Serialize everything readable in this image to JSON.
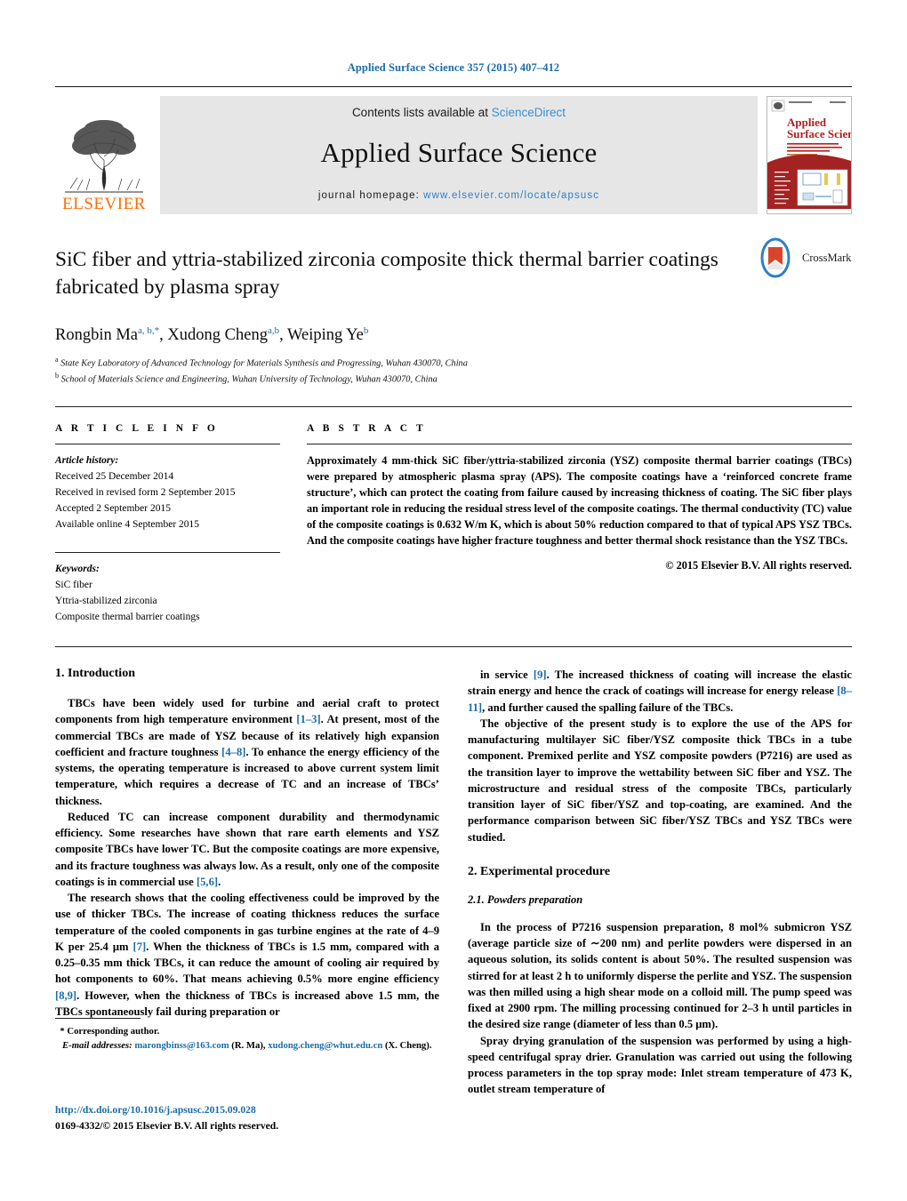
{
  "running_head": "Applied Surface Science 357 (2015) 407–412",
  "masthead": {
    "contents_prefix": "Contents lists available at ",
    "sciencedirect": "ScienceDirect",
    "journal_title": "Applied Surface Science",
    "homepage_prefix": "journal homepage: ",
    "homepage_url": "www.elsevier.com/locate/apsusc",
    "publisher_wordmark": "ELSEVIER",
    "cover_title_line1": "Applied",
    "cover_title_line2": "Surface Science",
    "accent_link_color": "#2f7fc4",
    "running_head_color": "#1b6ca8"
  },
  "article": {
    "title": "SiC fiber and yttria-stabilized zirconia composite thick thermal barrier coatings fabricated by plasma spray",
    "crossmark_label": "CrossMark",
    "authors": [
      {
        "name": "Rongbin Ma",
        "marks": "a, b,*"
      },
      {
        "name": "Xudong Cheng",
        "marks": "a,b"
      },
      {
        "name": "Weiping Ye",
        "marks": "b"
      }
    ],
    "affiliations": [
      {
        "mark": "a",
        "text": "State Key Laboratory of Advanced Technology for Materials Synthesis and Progressing, Wuhan 430070, China"
      },
      {
        "mark": "b",
        "text": "School of Materials Science and Engineering, Wuhan University of Technology, Wuhan 430070, China"
      }
    ]
  },
  "info": {
    "heading": "A R T I C L E   I N F O",
    "history_label": "Article history:",
    "history": [
      "Received 25 December 2014",
      "Received in revised form 2 September 2015",
      "Accepted 2 September 2015",
      "Available online 4 September 2015"
    ],
    "keywords_label": "Keywords:",
    "keywords": [
      "SiC fiber",
      "Yttria-stabilized zirconia",
      "Composite thermal barrier coatings"
    ]
  },
  "abstract": {
    "heading": "A B S T R A C T",
    "text": "Approximately 4 mm-thick SiC fiber/yttria-stabilized zirconia (YSZ) composite thermal barrier coatings (TBCs) were prepared by atmospheric plasma spray (APS). The composite coatings have a ‘reinforced concrete frame structure’, which can protect the coating from failure caused by increasing thickness of coating. The SiC fiber plays an important role in reducing the residual stress level of the composite coatings. The thermal conductivity (TC) value of the composite coatings is 0.632 W/m K, which is about 50% reduction compared to that of typical APS YSZ TBCs. And the composite coatings have higher fracture toughness and better thermal shock resistance than the YSZ TBCs.",
    "copyright": "© 2015 Elsevier B.V. All rights reserved."
  },
  "body": {
    "left": {
      "section_heading": "1.  Introduction",
      "paragraphs": [
        "TBCs have been widely used for turbine and aerial craft to protect components from high temperature environment [1–3]. At present, most of the commercial TBCs are made of YSZ because of its relatively high expansion coefficient and fracture toughness [4–8]. To enhance the energy efficiency of the systems, the operating temperature is increased to above current system limit temperature, which requires a decrease of TC and an increase of TBCs’ thickness.",
        "Reduced TC can increase component durability and thermodynamic efficiency. Some researches have shown that rare earth elements and YSZ composite TBCs have lower TC. But the composite coatings are more expensive, and its fracture toughness was always low. As a result, only one of the composite coatings is in commercial use [5,6].",
        "The research shows that the cooling effectiveness could be improved by the use of thicker TBCs. The increase of coating thickness reduces the surface temperature of the cooled components in gas turbine engines at the rate of 4–9 K per 25.4 μm [7]. When the thickness of TBCs is 1.5 mm, compared with a 0.25–0.35 mm thick TBCs, it can reduce the amount of cooling air required by hot components to 60%. That means achieving 0.5% more engine efficiency [8,9]. However, when the thickness of TBCs is increased above 1.5 mm, the TBCs spontaneously fail during preparation or"
      ]
    },
    "right": {
      "paragraphs_top": [
        "in service [9]. The increased thickness of coating will increase the elastic strain energy and hence the crack of coatings will increase for energy release [8–11], and further caused the spalling failure of the TBCs.",
        "The objective of the present study is to explore the use of the APS for manufacturing multilayer SiC fiber/YSZ composite thick TBCs in a tube component. Premixed perlite and YSZ composite powders (P7216) are used as the transition layer to improve the wettability between SiC fiber and YSZ. The microstructure and residual stress of the composite TBCs, particularly transition layer of SiC fiber/YSZ and top-coating, are examined. And the performance comparison between SiC fiber/YSZ TBCs and YSZ TBCs were studied."
      ],
      "section_heading": "2.  Experimental procedure",
      "subsection_heading": "2.1.  Powders preparation",
      "paragraphs_bottom": [
        "In the process of P7216 suspension preparation, 8 mol% submicron YSZ (average particle size of ∼200 nm) and perlite powders were dispersed in an aqueous solution, its solids content is about 50%. The resulted suspension was stirred for at least 2 h to uniformly disperse the perlite and YSZ. The suspension was then milled using a high shear mode on a colloid mill. The pump speed was fixed at 2900 rpm. The milling processing continued for 2–3 h until particles in the desired size range (diameter of less than 0.5 μm).",
        "Spray drying granulation of the suspension was performed by using a high-speed centrifugal spray drier. Granulation was carried out using the following process parameters in the top spray mode: Inlet stream temperature of 473 K, outlet stream temperature of"
      ]
    }
  },
  "footer": {
    "corresponding_marker": "*",
    "corresponding_label": "Corresponding author.",
    "email_label": "E-mail addresses:",
    "email_1": "marongbinss@163.com",
    "email_1_owner": "(R. Ma),",
    "email_2": "xudong.cheng@whut.edu.cn",
    "email_2_owner": "(X. Cheng).",
    "doi_url": "http://dx.doi.org/10.1016/j.apsusc.2015.09.028",
    "issn_line": "0169-4332/© 2015 Elsevier B.V. All rights reserved."
  }
}
